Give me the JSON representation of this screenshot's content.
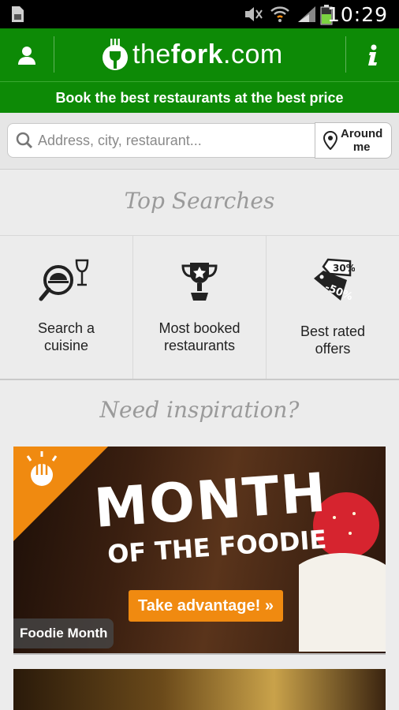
{
  "status_bar": {
    "time": "10:29"
  },
  "app_bar": {
    "logo_prefix": "the",
    "logo_bold": "fork",
    "logo_suffix": ".com",
    "brand_color": "#0d8a06"
  },
  "tagline": "Book the best restaurants at the best price",
  "search": {
    "placeholder": "Address, city, restaurant...",
    "around_me_label_1": "Around",
    "around_me_label_2": "me"
  },
  "top_searches": {
    "title": "Top Searches",
    "tiles": [
      {
        "line1": "Search a",
        "line2": "cuisine",
        "icon": "cuisine-search-icon"
      },
      {
        "line1": "Most booked",
        "line2": "restaurants",
        "icon": "trophy-icon"
      },
      {
        "line1": "Best rated",
        "line2": "offers",
        "icon": "discount-tag-icon"
      }
    ]
  },
  "inspiration": {
    "title": "Need inspiration?",
    "banner": {
      "headline": "MONTH",
      "subheadline": "OF THE FOODIE",
      "cta": "Take advantage! »",
      "caption": "Foodie Month",
      "accent_color": "#f08a10"
    }
  }
}
